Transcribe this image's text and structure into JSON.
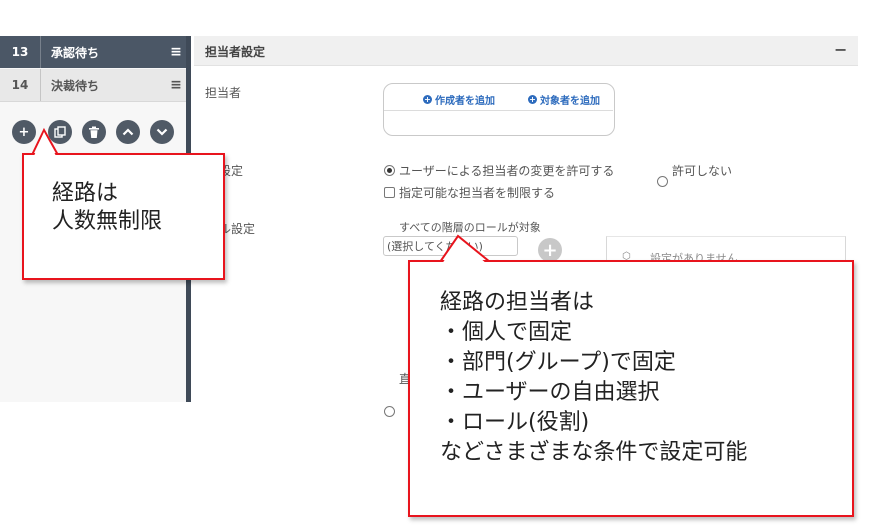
{
  "sidebar": {
    "steps": [
      {
        "number": "13",
        "label": "承認待ち",
        "menu_icon": "≡"
      },
      {
        "number": "14",
        "label": "決裁待ち",
        "menu_icon": "≡"
      }
    ],
    "actions": [
      "add-icon",
      "copy-icon",
      "trash-icon",
      "chevron-up-icon",
      "chevron-down-icon"
    ]
  },
  "panel": {
    "title": "担当者設定",
    "collapse_label": "−",
    "assignee_label": "担当者",
    "add_creator": "作成者を追加",
    "add_target": "対象者を追加",
    "detail_label": "詳細設定",
    "detail_options": {
      "allow_change": "ユーザーによる担当者の変更を許可する",
      "disallow": "許可しない",
      "restrict": "指定可能な担当者を制限する"
    },
    "role_label": "ロール設定",
    "role_option": "すべての階層のロールが対象",
    "role_select_value": "(選択してください)",
    "role_add": "+",
    "empty_message": "設定がありません",
    "bottom_option": "直"
  },
  "callouts": {
    "route": [
      "経路は",
      "人数無制限"
    ],
    "assignee": [
      "経路の担当者は",
      "・個人で固定",
      "・部門(グループ)で固定",
      "・ユーザーの自由選択",
      "・ロール(役割)",
      "などさまざまな条件で設定可能"
    ]
  },
  "colors": {
    "accent_blue": "#2d6bbd",
    "sidebar_dark": "#4b5766",
    "callout_red": "#e8141d"
  }
}
